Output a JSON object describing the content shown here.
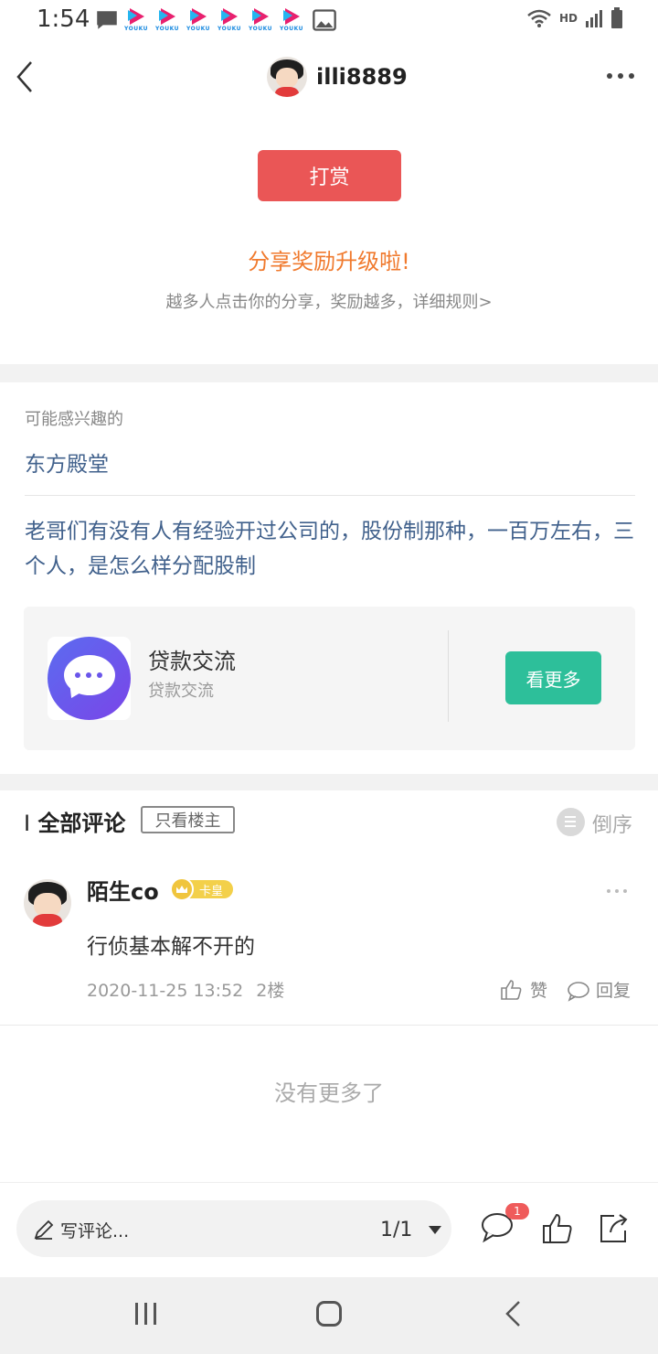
{
  "status_bar": {
    "time": "1:54",
    "network": "HD",
    "youku_label": "YOUKU"
  },
  "header": {
    "username": "illi8889"
  },
  "reward": {
    "button_label": "打赏",
    "share_title": "分享奖励升级啦!",
    "share_subtitle": "越多人点击你的分享，奖励越多，详细规则>"
  },
  "recommend": {
    "label": "可能感兴趣的",
    "items": [
      "东方殿堂",
      "老哥们有没有人有经验开过公司的，股份制那种，一百万左右，三个人，是怎么样分配股制"
    ],
    "group": {
      "name": "贷款交流",
      "description": "贷款交流",
      "see_more_label": "看更多"
    }
  },
  "comments": {
    "title": "全部评论",
    "only_owner_label": "只看楼主",
    "sort_label": "倒序",
    "items": [
      {
        "user": "陌生co",
        "badge": "卡皇",
        "text": "行侦基本解不开的",
        "datetime": "2020-11-25 13:52",
        "floor": "2楼",
        "like_label": "赞",
        "reply_label": "回复"
      }
    ],
    "no_more": "没有更多了"
  },
  "bottom_bar": {
    "write_placeholder": "写评论...",
    "page_indicator": "1/1",
    "comment_count": "1"
  },
  "colors": {
    "reward_button": "#ea5656",
    "share_title": "#f07a2e",
    "link_blue": "#41618c",
    "see_more_button": "#2dbf9a",
    "badge_red": "#ef5b5b"
  }
}
